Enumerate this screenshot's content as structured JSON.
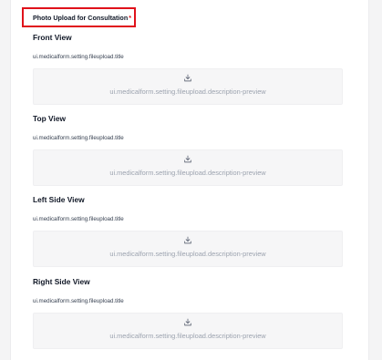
{
  "section": {
    "title": "Photo Upload for Consultation",
    "required_marker": "*"
  },
  "views": [
    {
      "title": "Front View",
      "subtitle": "ui.medicalform.setting.fileupload.title",
      "dropzone_text": "ui.medicalform.setting.fileupload.description-preview",
      "icon": "upload-icon"
    },
    {
      "title": "Top View",
      "subtitle": "ui.medicalform.setting.fileupload.title",
      "dropzone_text": "ui.medicalform.setting.fileupload.description-preview",
      "icon": "upload-icon"
    },
    {
      "title": "Left Side View",
      "subtitle": "ui.medicalform.setting.fileupload.title",
      "dropzone_text": "ui.medicalform.setting.fileupload.description-preview",
      "icon": "upload-icon"
    },
    {
      "title": "Right Side View",
      "subtitle": "ui.medicalform.setting.fileupload.title",
      "dropzone_text": "ui.medicalform.setting.fileupload.description-preview",
      "icon": "upload-icon"
    }
  ],
  "colors": {
    "highlight_border": "#e0121b",
    "required_marker": "#e0121b",
    "dropzone_bg": "#f6f6f7",
    "placeholder_text": "#9ca3af"
  }
}
